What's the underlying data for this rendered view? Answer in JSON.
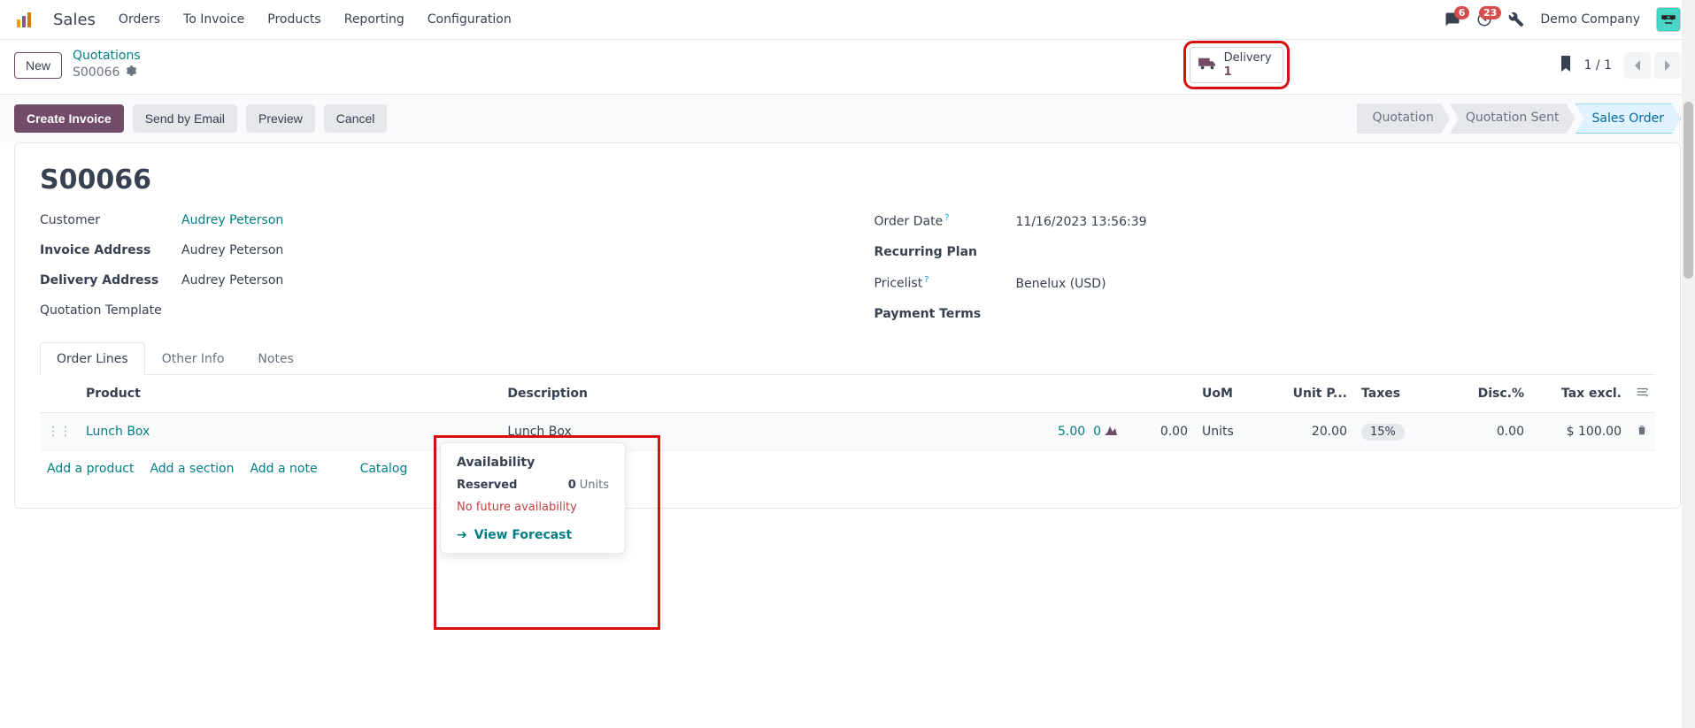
{
  "nav": {
    "app": "Sales",
    "menus": [
      "Orders",
      "To Invoice",
      "Products",
      "Reporting",
      "Configuration"
    ],
    "chat_badge": "6",
    "clock_badge": "23",
    "company": "Demo Company"
  },
  "control": {
    "new": "New",
    "breadcrumb_top": "Quotations",
    "breadcrumb_id": "S00066",
    "stat_label": "Delivery",
    "stat_count": "1",
    "pager": "1 / 1"
  },
  "actions": {
    "create_invoice": "Create Invoice",
    "send_email": "Send by Email",
    "preview": "Preview",
    "cancel": "Cancel"
  },
  "status": {
    "quotation": "Quotation",
    "quotation_sent": "Quotation Sent",
    "sales_order": "Sales Order"
  },
  "record": {
    "title": "S00066",
    "customer_lbl": "Customer",
    "customer_val": "Audrey Peterson",
    "invoice_lbl": "Invoice Address",
    "invoice_val": "Audrey Peterson",
    "delivery_lbl": "Delivery Address",
    "delivery_val": "Audrey Peterson",
    "template_lbl": "Quotation Template",
    "order_date_lbl": "Order Date",
    "order_date_val": "11/16/2023 13:56:39",
    "recurring_lbl": "Recurring Plan",
    "pricelist_lbl": "Pricelist",
    "pricelist_val": "Benelux (USD)",
    "payment_lbl": "Payment Terms"
  },
  "tabs": {
    "order_lines": "Order Lines",
    "other_info": "Other Info",
    "notes": "Notes"
  },
  "grid": {
    "h_product": "Product",
    "h_description": "Description",
    "h_uom": "UoM",
    "h_unit_price": "Unit P...",
    "h_taxes": "Taxes",
    "h_disc": "Disc.%",
    "h_tax_excl": "Tax excl.",
    "row": {
      "product": "Lunch Box",
      "description": "Lunch Box",
      "qty": "5.00",
      "qty2": "0",
      "delivered": "0.00",
      "uom": "Units",
      "unit_price": "20.00",
      "taxes": "15%",
      "disc": "0.00",
      "tax_excl": "$ 100.00"
    },
    "add_product": "Add a product",
    "add_section": "Add a section",
    "add_note": "Add a note",
    "catalog": "Catalog"
  },
  "popover": {
    "title": "Availability",
    "reserved_lbl": "Reserved",
    "reserved_val": "0",
    "reserved_unit": "Units",
    "warn": "No future availability",
    "forecast": "View Forecast"
  }
}
